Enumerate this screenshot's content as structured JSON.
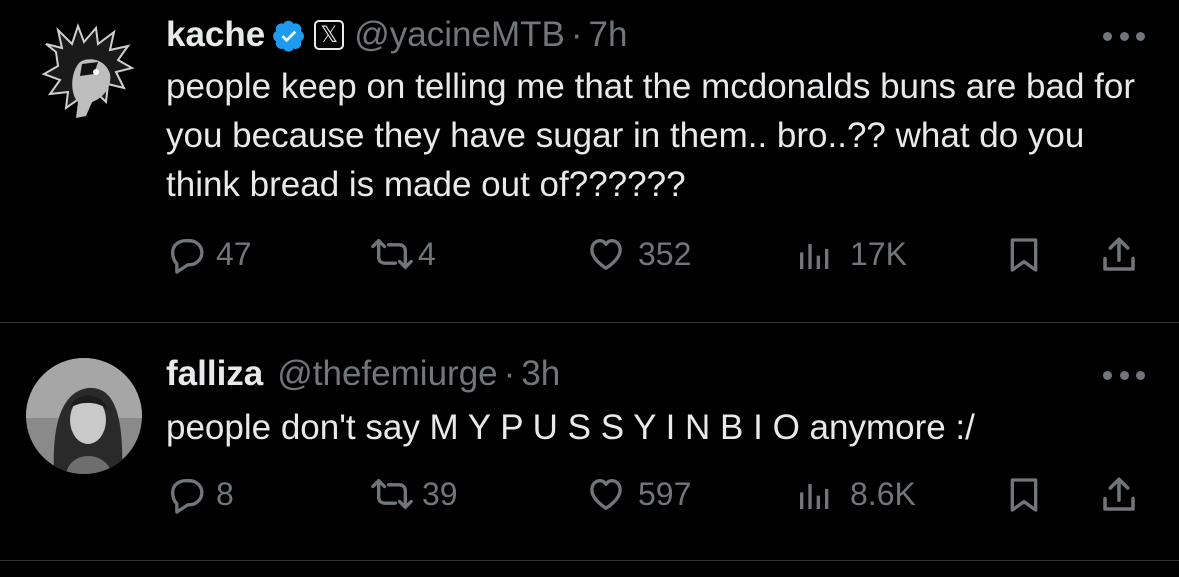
{
  "tweets": [
    {
      "author_name": "kache",
      "handle": "@yacineMTB",
      "separator": "·",
      "time": "7h",
      "affiliate_badge": "𝕏",
      "text": "people keep on telling me that the mcdonalds buns are bad for you because they have sugar in them.. bro..?? what do you think bread is made out of??????",
      "replies": "47",
      "reposts": "4",
      "likes": "352",
      "views": "17K"
    },
    {
      "author_name": "falliza",
      "handle": "@thefemiurge",
      "separator": "·",
      "time": "3h",
      "text": "people don't say M Y P U S S Y I N B I O anymore :/",
      "replies": "8",
      "reposts": "39",
      "likes": "597",
      "views": "8.6K"
    }
  ],
  "colors": {
    "background": "#000000",
    "primary_text": "#e7e9ea",
    "secondary_text": "#71767b",
    "verified_blue": "#1d9bf0",
    "divider": "#2f3336"
  },
  "icons": [
    "reply-icon",
    "repost-icon",
    "like-icon",
    "views-icon",
    "bookmark-icon",
    "share-icon",
    "more-icon",
    "verified-icon"
  ]
}
